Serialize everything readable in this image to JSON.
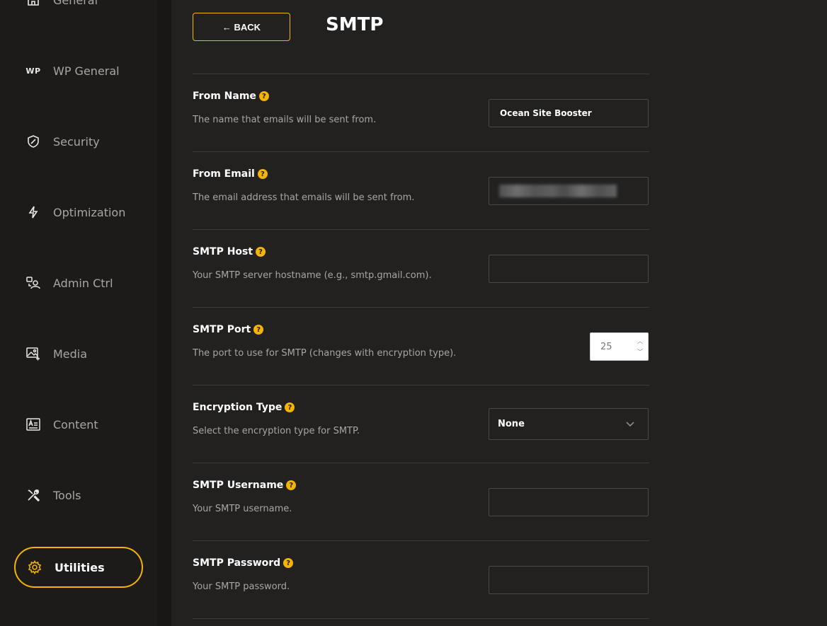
{
  "sidebar": {
    "items": [
      {
        "label": "General",
        "icon": "home-icon"
      },
      {
        "label": "WP General",
        "icon": "wp-icon",
        "icon_text": "WP"
      },
      {
        "label": "Security",
        "icon": "shield-icon"
      },
      {
        "label": "Optimization",
        "icon": "lightning-icon"
      },
      {
        "label": "Admin Ctrl",
        "icon": "admin-users-icon"
      },
      {
        "label": "Media",
        "icon": "media-image-icon"
      },
      {
        "label": "Content",
        "icon": "content-icon"
      },
      {
        "label": "Tools",
        "icon": "tools-icon"
      },
      {
        "label": "Utilities",
        "icon": "gear-icon",
        "active": true
      }
    ]
  },
  "header": {
    "back_label": "← BACK",
    "title": "SMTP"
  },
  "fields": {
    "from_name": {
      "title": "From Name",
      "desc": "The name that emails will be sent from.",
      "value": "Ocean Site Booster"
    },
    "from_email": {
      "title": "From Email",
      "desc": "The email address that emails will be sent from."
    },
    "smtp_host": {
      "title": "SMTP Host",
      "desc": "Your SMTP server hostname (e.g., smtp.gmail.com).",
      "value": ""
    },
    "smtp_port": {
      "title": "SMTP Port",
      "desc": "The port to use for SMTP (changes with encryption type).",
      "value": "25"
    },
    "encryption": {
      "title": "Encryption Type",
      "desc": "Select the encryption type for SMTP.",
      "value": "None"
    },
    "smtp_username": {
      "title": "SMTP Username",
      "desc": "Your SMTP username.",
      "value": ""
    },
    "smtp_password": {
      "title": "SMTP Password",
      "desc": "Your SMTP password.",
      "value": ""
    }
  },
  "help_glyph": "?",
  "colors": {
    "accent": "#f5b400",
    "background": "#222120",
    "sidebar": "#1c1b1a"
  }
}
